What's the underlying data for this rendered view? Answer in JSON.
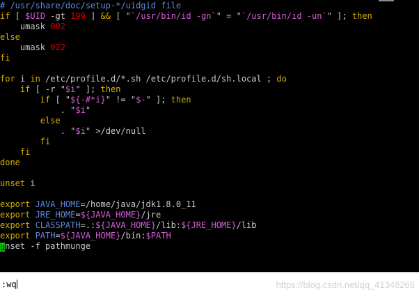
{
  "colors": {
    "background": "#000000",
    "text": "#c9c9c9",
    "comment": "#5f87d7",
    "keyword": "#d7af00",
    "string": "#d75fd7",
    "number": "#d70000",
    "operator": "#d7af00",
    "cursor": "#00c000",
    "status_bg": "#ffffff"
  },
  "editor": {
    "lines": [
      [
        {
          "t": "# /usr/share/doc/setup-*/uidgid file",
          "c": "comment"
        }
      ],
      [
        {
          "t": "if",
          "c": "keyword"
        },
        {
          "t": " [ ",
          "c": "text"
        },
        {
          "t": "$UID",
          "c": "string"
        },
        {
          "t": " -gt ",
          "c": "text"
        },
        {
          "t": "199",
          "c": "number"
        },
        {
          "t": " ] ",
          "c": "text"
        },
        {
          "t": "&&",
          "c": "operator"
        },
        {
          "t": " [ \"",
          "c": "text"
        },
        {
          "t": "`/usr/bin/id -gn`",
          "c": "string"
        },
        {
          "t": "\" = \"",
          "c": "text"
        },
        {
          "t": "`/usr/bin/id -un`",
          "c": "string"
        },
        {
          "t": "\" ]; ",
          "c": "text"
        },
        {
          "t": "then",
          "c": "keyword"
        }
      ],
      [
        {
          "t": "    umask ",
          "c": "text"
        },
        {
          "t": "002",
          "c": "number"
        }
      ],
      [
        {
          "t": "else",
          "c": "keyword"
        }
      ],
      [
        {
          "t": "    umask ",
          "c": "text"
        },
        {
          "t": "022",
          "c": "number"
        }
      ],
      [
        {
          "t": "fi",
          "c": "keyword"
        }
      ],
      [
        {
          "t": "",
          "c": "text"
        }
      ],
      [
        {
          "t": "for",
          "c": "keyword"
        },
        {
          "t": " i ",
          "c": "text"
        },
        {
          "t": "in",
          "c": "keyword"
        },
        {
          "t": " /etc/profile.d/*.sh /etc/profile.d/sh.local ; ",
          "c": "text"
        },
        {
          "t": "do",
          "c": "keyword"
        }
      ],
      [
        {
          "t": "    ",
          "c": "text"
        },
        {
          "t": "if",
          "c": "keyword"
        },
        {
          "t": " [ -r \"",
          "c": "text"
        },
        {
          "t": "$i",
          "c": "string"
        },
        {
          "t": "\" ]; ",
          "c": "text"
        },
        {
          "t": "then",
          "c": "keyword"
        }
      ],
      [
        {
          "t": "        ",
          "c": "text"
        },
        {
          "t": "if",
          "c": "keyword"
        },
        {
          "t": " [ \"",
          "c": "text"
        },
        {
          "t": "${-#*i}",
          "c": "string"
        },
        {
          "t": "\" != \"",
          "c": "text"
        },
        {
          "t": "$-",
          "c": "string"
        },
        {
          "t": "\" ]; ",
          "c": "text"
        },
        {
          "t": "then",
          "c": "keyword"
        }
      ],
      [
        {
          "t": "            . \"",
          "c": "text"
        },
        {
          "t": "$i",
          "c": "string"
        },
        {
          "t": "\"",
          "c": "text"
        }
      ],
      [
        {
          "t": "        ",
          "c": "text"
        },
        {
          "t": "else",
          "c": "keyword"
        }
      ],
      [
        {
          "t": "            . \"",
          "c": "text"
        },
        {
          "t": "$i",
          "c": "string"
        },
        {
          "t": "\" >/dev/null",
          "c": "text"
        }
      ],
      [
        {
          "t": "        ",
          "c": "text"
        },
        {
          "t": "fi",
          "c": "keyword"
        }
      ],
      [
        {
          "t": "    ",
          "c": "text"
        },
        {
          "t": "fi",
          "c": "keyword"
        }
      ],
      [
        {
          "t": "done",
          "c": "keyword"
        }
      ],
      [
        {
          "t": "",
          "c": "text"
        }
      ],
      [
        {
          "t": "unset",
          "c": "keyword"
        },
        {
          "t": " i",
          "c": "text"
        }
      ],
      [
        {
          "t": "",
          "c": "text"
        }
      ],
      [
        {
          "t": "export",
          "c": "keyword"
        },
        {
          "t": " JAVA_HOME",
          "c": "comment"
        },
        {
          "t": "=/home/java/jdk1.8.0_11",
          "c": "text"
        }
      ],
      [
        {
          "t": "export",
          "c": "keyword"
        },
        {
          "t": " JRE_HOME",
          "c": "comment"
        },
        {
          "t": "=",
          "c": "text"
        },
        {
          "t": "${JAVA_HOME}",
          "c": "string"
        },
        {
          "t": "/jre",
          "c": "text"
        }
      ],
      [
        {
          "t": "export",
          "c": "keyword"
        },
        {
          "t": " CLASSPATH",
          "c": "comment"
        },
        {
          "t": "=.:",
          "c": "text"
        },
        {
          "t": "${JAVA_HOME}",
          "c": "string"
        },
        {
          "t": "/lib:",
          "c": "text"
        },
        {
          "t": "${JRE_HOME}",
          "c": "string"
        },
        {
          "t": "/lib",
          "c": "text"
        }
      ],
      [
        {
          "t": "export",
          "c": "keyword"
        },
        {
          "t": " PATH",
          "c": "comment"
        },
        {
          "t": "=",
          "c": "text"
        },
        {
          "t": "${JAVA_HOME}",
          "c": "string"
        },
        {
          "t": "/bin:",
          "c": "text"
        },
        {
          "t": "$PATH",
          "c": "string"
        }
      ],
      [
        {
          "t": "CURSOR",
          "c": "cursor"
        },
        {
          "t": "nset -f pathmunge",
          "c": "text"
        }
      ]
    ],
    "cursor_char": "u"
  },
  "cmdline": {
    "text": ":wq"
  },
  "watermark": {
    "text": "https://blog.csdn.net/qq_41348266"
  }
}
